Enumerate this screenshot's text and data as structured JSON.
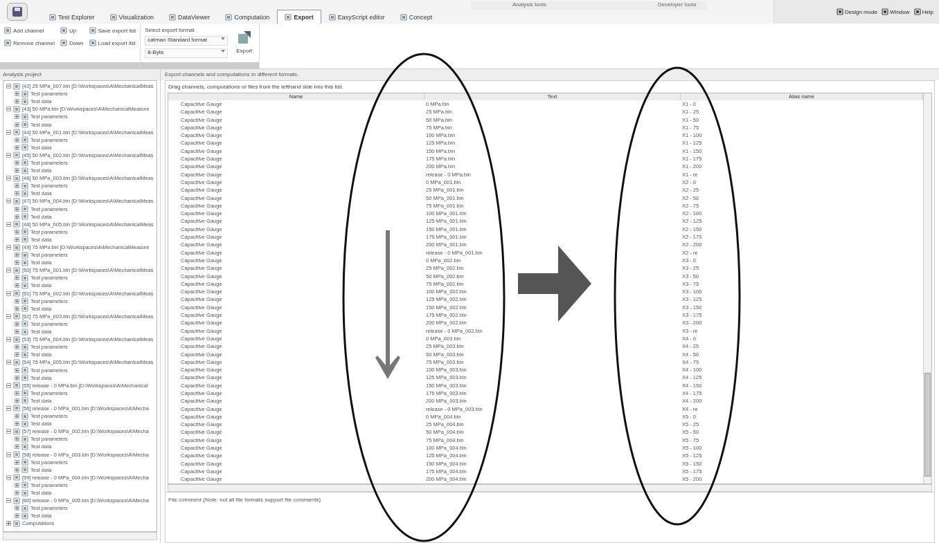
{
  "context_labels": [
    "Analysis tools",
    "Developer tools"
  ],
  "tabs": [
    {
      "label": "Test Explorer",
      "selected": false
    },
    {
      "label": "Visualization",
      "selected": false
    },
    {
      "label": "DataViewer",
      "selected": false
    },
    {
      "label": "Computation",
      "selected": false
    },
    {
      "label": "Export",
      "selected": true
    },
    {
      "label": "EasyScript editor",
      "selected": false
    },
    {
      "label": "Concept",
      "selected": false
    }
  ],
  "right_menu": [
    "Design mode",
    "Window",
    "Help"
  ],
  "ribbon": {
    "channel_buttons": [
      "Add channel",
      "Remove channel"
    ],
    "move_buttons": [
      "Up",
      "Down"
    ],
    "list_buttons": [
      "Save export list",
      "Load export list"
    ],
    "format_label": "Select export format",
    "format_dropdowns": [
      "catman Standard format",
      "8-Byte"
    ],
    "export_button": "Export"
  },
  "left_panel": {
    "title": "Analysis project",
    "tree": [
      {
        "label": "[42] 25 MPa_007.bin [D:\\Workspaces\\A\\MechanicalMeas",
        "expanded": true,
        "children": [
          {
            "label": "Test parameters",
            "expanded": false
          },
          {
            "label": "Test data",
            "expanded": false
          }
        ]
      },
      {
        "label": "[43] 50 MPa.bin [D:\\Workspaces\\A\\MechanicalMeasure",
        "expanded": true,
        "children": [
          {
            "label": "Test parameters",
            "expanded": false
          },
          {
            "label": "Test data",
            "expanded": false
          }
        ]
      },
      {
        "label": "[44] 50 MPa_001.bin [D:\\Workspaces\\A\\MechanicalMeas",
        "expanded": true,
        "children": [
          {
            "label": "Test parameters",
            "expanded": false
          },
          {
            "label": "Test data",
            "expanded": false
          }
        ]
      },
      {
        "label": "[45] 50 MPa_002.bin [D:\\Workspaces\\A\\MechanicalMeas",
        "expanded": true,
        "children": [
          {
            "label": "Test parameters",
            "expanded": false
          },
          {
            "label": "Test data",
            "expanded": false
          }
        ]
      },
      {
        "label": "[46] 50 MPa_003.bin [D:\\Workspaces\\A\\MechanicalMeas",
        "expanded": true,
        "children": [
          {
            "label": "Test parameters",
            "expanded": false
          },
          {
            "label": "Test data",
            "expanded": false
          }
        ]
      },
      {
        "label": "[47] 50 MPa_004.bin [D:\\Workspaces\\A\\MechanicalMeas",
        "expanded": true,
        "children": [
          {
            "label": "Test parameters",
            "expanded": false
          },
          {
            "label": "Test data",
            "expanded": false
          }
        ]
      },
      {
        "label": "[48] 50 MPa_005.bin [D:\\Workspaces\\A\\MechanicalMeas",
        "expanded": true,
        "children": [
          {
            "label": "Test parameters",
            "expanded": false
          },
          {
            "label": "Test data",
            "expanded": false
          }
        ]
      },
      {
        "label": "[49] 75 MPa.bin [D:\\Workspaces\\A\\MechanicalMeasure",
        "expanded": true,
        "children": [
          {
            "label": "Test parameters",
            "expanded": false
          },
          {
            "label": "Test data",
            "expanded": false
          }
        ]
      },
      {
        "label": "[50] 75 MPa_001.bin [D:\\Workspaces\\A\\MechanicalMeas",
        "expanded": true,
        "children": [
          {
            "label": "Test parameters",
            "expanded": false
          },
          {
            "label": "Test data",
            "expanded": false
          }
        ]
      },
      {
        "label": "[51] 75 MPa_002.bin [D:\\Workspaces\\A\\MechanicalMeas",
        "expanded": true,
        "children": [
          {
            "label": "Test parameters",
            "expanded": false
          },
          {
            "label": "Test data",
            "expanded": false
          }
        ]
      },
      {
        "label": "[52] 75 MPa_003.bin [D:\\Workspaces\\A\\MechanicalMeas",
        "expanded": true,
        "children": [
          {
            "label": "Test parameters",
            "expanded": false
          },
          {
            "label": "Test data",
            "expanded": false
          }
        ]
      },
      {
        "label": "[53] 75 MPa_004.bin [D:\\Workspaces\\A\\MechanicalMeas",
        "expanded": true,
        "children": [
          {
            "label": "Test parameters",
            "expanded": false
          },
          {
            "label": "Test data",
            "expanded": false
          }
        ]
      },
      {
        "label": "[54] 75 MPa_005.bin [D:\\Workspaces\\A\\MechanicalMeas",
        "expanded": true,
        "children": [
          {
            "label": "Test parameters",
            "expanded": false
          },
          {
            "label": "Test data",
            "expanded": false
          }
        ]
      },
      {
        "label": "[55] release - 0 MPa.bin [D:\\Workspaces\\A\\Mechanical",
        "expanded": true,
        "children": [
          {
            "label": "Test parameters",
            "expanded": false
          },
          {
            "label": "Test data",
            "expanded": false
          }
        ]
      },
      {
        "label": "[56] release - 0 MPa_001.bin [D:\\Workspaces\\A\\Mecha",
        "expanded": true,
        "children": [
          {
            "label": "Test parameters",
            "expanded": false
          },
          {
            "label": "Test data",
            "expanded": false
          }
        ]
      },
      {
        "label": "[57] release - 0 MPa_002.bin [D:\\Workspaces\\A\\Mecha",
        "expanded": true,
        "children": [
          {
            "label": "Test parameters",
            "expanded": false
          },
          {
            "label": "Test data",
            "expanded": false
          }
        ]
      },
      {
        "label": "[58] release - 0 MPa_003.bin [D:\\Workspaces\\A\\Mecha",
        "expanded": true,
        "children": [
          {
            "label": "Test parameters",
            "expanded": false
          },
          {
            "label": "Test data",
            "expanded": false
          }
        ]
      },
      {
        "label": "[59] release - 0 MPa_004.bin [D:\\Workspaces\\A\\Mecha",
        "expanded": true,
        "children": [
          {
            "label": "Test parameters",
            "expanded": false
          },
          {
            "label": "Test data",
            "expanded": false
          }
        ]
      },
      {
        "label": "[60] release - 0 MPa_005.bin [D:\\Workspaces\\A\\Mecha",
        "expanded": true,
        "children": [
          {
            "label": "Test parameters",
            "expanded": false
          },
          {
            "label": "Test data",
            "expanded": false
          }
        ]
      },
      {
        "label": "Computations",
        "expanded": false
      }
    ]
  },
  "main": {
    "description": "Export channels and computations in different formats.",
    "hint": "Drag channels, computations or files from the lefthand side into this list.",
    "columns": [
      "Name",
      "Text",
      "Alias name"
    ],
    "rows": [
      [
        "Capacitive Gauge",
        "0 MPa.bin",
        "X1 - 0"
      ],
      [
        "Capacitive Gauge",
        "25 MPa.bin",
        "X1 - 25"
      ],
      [
        "Capacitive Gauge",
        "50 MPa.bin",
        "X1 - 50"
      ],
      [
        "Capacitive Gauge",
        "75 MPa.bin",
        "X1 - 75"
      ],
      [
        "Capacitive Gauge",
        "100 MPa.bin",
        "X1 - 100"
      ],
      [
        "Capacitive Gauge",
        "125 MPa.bin",
        "X1 - 125"
      ],
      [
        "Capacitive Gauge",
        "150 MPa.bin",
        "X1 - 150"
      ],
      [
        "Capacitive Gauge",
        "175 MPa.bin",
        "X1 - 175"
      ],
      [
        "Capacitive Gauge",
        "200 MPa.bin",
        "X1 - 200"
      ],
      [
        "Capacitive Gauge",
        "release - 0 MPa.bin",
        "X1 - re"
      ],
      [
        "Capacitive Gauge",
        "0 MPa_001.bin",
        "X2 - 0"
      ],
      [
        "Capacitive Gauge",
        "25 MPa_001.bin",
        "X2 - 25"
      ],
      [
        "Capacitive Gauge",
        "50 MPa_001.bin",
        "X2 - 50"
      ],
      [
        "Capacitive Gauge",
        "75 MPa_001.bin",
        "X2 - 75"
      ],
      [
        "Capacitive Gauge",
        "100 MPa_001.bin",
        "X2 - 100"
      ],
      [
        "Capacitive Gauge",
        "125 MPa_001.bin",
        "X2 - 125"
      ],
      [
        "Capacitive Gauge",
        "150 MPa_001.bin",
        "X2 - 150"
      ],
      [
        "Capacitive Gauge",
        "175 MPa_001.bin",
        "X2 - 175"
      ],
      [
        "Capacitive Gauge",
        "200 MPa_001.bin",
        "X2 - 200"
      ],
      [
        "Capacitive Gauge",
        "release - 0 MPa_001.bin",
        "X2 - re"
      ],
      [
        "Capacitive Gauge",
        "0 MPa_002.bin",
        "X3 - 0"
      ],
      [
        "Capacitive Gauge",
        "25 MPa_002.bin",
        "X3 - 25"
      ],
      [
        "Capacitive Gauge",
        "50 MPa_002.bin",
        "X3 - 50"
      ],
      [
        "Capacitive Gauge",
        "75 MPa_002.bin",
        "X3 - 75"
      ],
      [
        "Capacitive Gauge",
        "100 MPa_002.bin",
        "X3 - 100"
      ],
      [
        "Capacitive Gauge",
        "125 MPa_002.bin",
        "X3 - 125"
      ],
      [
        "Capacitive Gauge",
        "150 MPa_002.bin",
        "X3 - 150"
      ],
      [
        "Capacitive Gauge",
        "175 MPa_002.bin",
        "X3 - 175"
      ],
      [
        "Capacitive Gauge",
        "200 MPa_002.bin",
        "X3 - 200"
      ],
      [
        "Capacitive Gauge",
        "release - 0 MPa_002.bin",
        "X3 - re"
      ],
      [
        "Capacitive Gauge",
        "0 MPa_003.bin",
        "X4 - 0"
      ],
      [
        "Capacitive Gauge",
        "25 MPa_003.bin",
        "X4 - 25"
      ],
      [
        "Capacitive Gauge",
        "50 MPa_003.bin",
        "X4 - 50"
      ],
      [
        "Capacitive Gauge",
        "75 MPa_003.bin",
        "X4 - 75"
      ],
      [
        "Capacitive Gauge",
        "100 MPa_003.bin",
        "X4 - 100"
      ],
      [
        "Capacitive Gauge",
        "125 MPa_003.bin",
        "X4 - 125"
      ],
      [
        "Capacitive Gauge",
        "150 MPa_003.bin",
        "X4 - 150"
      ],
      [
        "Capacitive Gauge",
        "175 MPa_003.bin",
        "X4 - 175"
      ],
      [
        "Capacitive Gauge",
        "200 MPa_003.bin",
        "X4 - 200"
      ],
      [
        "Capacitive Gauge",
        "release - 0 MPa_003.bin",
        "X4 - re"
      ],
      [
        "Capacitive Gauge",
        "0 MPa_004.bin",
        "X5 - 0"
      ],
      [
        "Capacitive Gauge",
        "25 MPa_004.bin",
        "X5 - 25"
      ],
      [
        "Capacitive Gauge",
        "50 MPa_004.bin",
        "X5 - 50"
      ],
      [
        "Capacitive Gauge",
        "75 MPa_004.bin",
        "X5 - 75"
      ],
      [
        "Capacitive Gauge",
        "100 MPa_004.bin",
        "X5 - 100"
      ],
      [
        "Capacitive Gauge",
        "125 MPa_004.bin",
        "X5 - 125"
      ],
      [
        "Capacitive Gauge",
        "150 MPa_004.bin",
        "X5 - 150"
      ],
      [
        "Capacitive Gauge",
        "175 MPa_004.bin",
        "X5 - 175"
      ],
      [
        "Capacitive Gauge",
        "200 MPa_004.bin",
        "X5 - 200"
      ]
    ],
    "file_comment": "File comment (Note: not all file formats support file comments)"
  }
}
